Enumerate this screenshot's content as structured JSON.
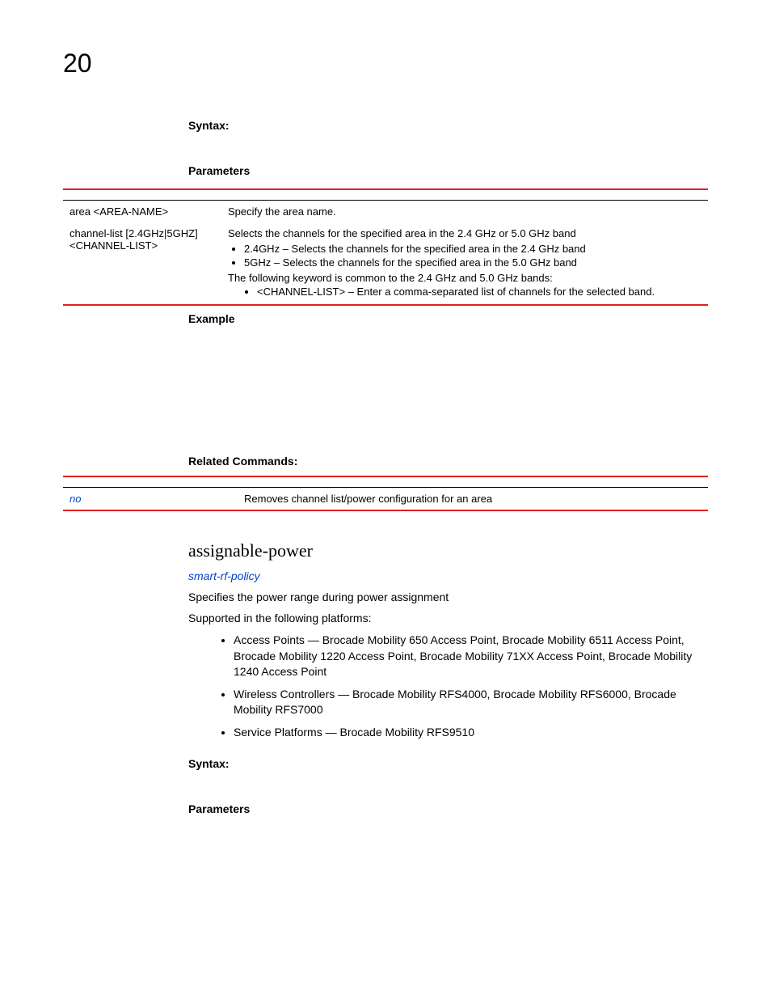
{
  "chapter": "20",
  "top": {
    "syntax_label": "Syntax:",
    "parameters_label": "Parameters",
    "table": {
      "row1": {
        "left": "area <AREA-NAME>",
        "right": "Specify the area name."
      },
      "row2": {
        "left_line1": "channel-list [2.4GHz|5GHZ]",
        "left_line2": "<CHANNEL-LIST>",
        "intro": "Selects the channels for the specified area in the 2.4 GHz or 5.0 GHz band",
        "b1": "2.4GHz – Selects the channels for the specified area in the 2.4 GHz band",
        "b2": "5GHz – Selects the channels for the specified area in the 5.0 GHz band",
        "common": "The following keyword is common to the 2.4 GHz and 5.0 GHz bands:",
        "b3": "<CHANNEL-LIST> – Enter a comma-separated list of channels for the selected band."
      }
    },
    "example_label": "Example",
    "related_label": "Related Commands:",
    "related": {
      "no_label": "no",
      "no_desc": "Removes channel list/power configuration for an area"
    }
  },
  "cmd": {
    "title": "assignable-power",
    "context_link": "smart-rf-policy",
    "desc": "Specifies the power range during power assignment",
    "supported_label": "Supported in the following platforms:",
    "platforms": {
      "ap": "Access Points — Brocade Mobility 650 Access Point, Brocade Mobility 6511 Access Point, Brocade Mobility 1220 Access Point, Brocade Mobility 71XX Access Point, Brocade Mobility 1240 Access Point",
      "wc": "Wireless Controllers — Brocade Mobility RFS4000, Brocade Mobility RFS6000, Brocade Mobility RFS7000",
      "sp": "Service Platforms — Brocade Mobility RFS9510"
    },
    "syntax_label": "Syntax:",
    "parameters_label": "Parameters"
  }
}
